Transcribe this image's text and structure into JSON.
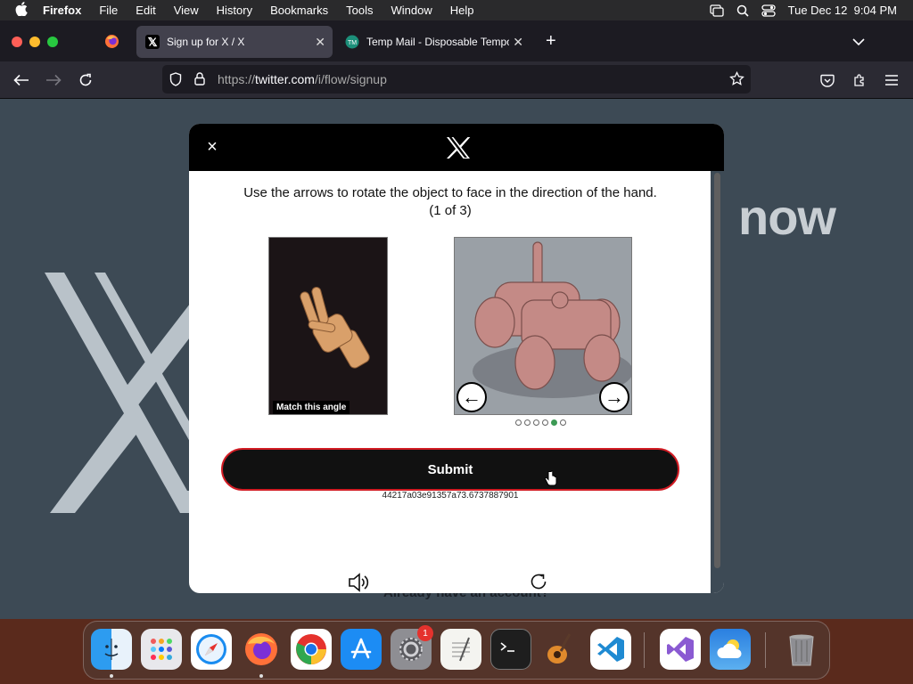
{
  "menubar": {
    "app_name": "Firefox",
    "items": [
      "File",
      "Edit",
      "View",
      "History",
      "Bookmarks",
      "Tools",
      "Window",
      "Help"
    ],
    "datetime": "Tue Dec 12  9:04 PM"
  },
  "tabs": [
    {
      "label": "Sign up for X / X",
      "active": true
    },
    {
      "label": "Temp Mail - Disposable Tempor",
      "active": false
    }
  ],
  "urlbar": {
    "prefix": "https://",
    "domain": "twitter.com",
    "path": "/i/flow/signup"
  },
  "background": {
    "headline": "now",
    "footer_text": "Already have an account?"
  },
  "modal": {
    "close_icon": "×",
    "instruction": "Use the arrows to rotate the object to face in the direction of the hand.",
    "progress": "(1 of 3)",
    "hand_caption": "Match this angle",
    "left_arrow": "←",
    "right_arrow": "→",
    "dots_total": 6,
    "dots_active_index": 4,
    "submit_label": "Submit",
    "session_id": "44217a03e91357a73.6737887901"
  },
  "dock": {
    "items": [
      "finder-icon",
      "launchpad-icon",
      "safari-icon",
      "firefox-icon",
      "chrome-icon",
      "app-store-icon",
      "system-settings-icon",
      "textedit-icon",
      "terminal-icon",
      "garageband-icon",
      "vscode-icon",
      "visual-studio-icon",
      "weather-icon",
      "trash-icon"
    ],
    "settings_badge": "1"
  },
  "colors": {
    "accent_submit_border": "#d21c24",
    "dot_active": "#3d9a55",
    "page_bg": "#3d4a55"
  }
}
